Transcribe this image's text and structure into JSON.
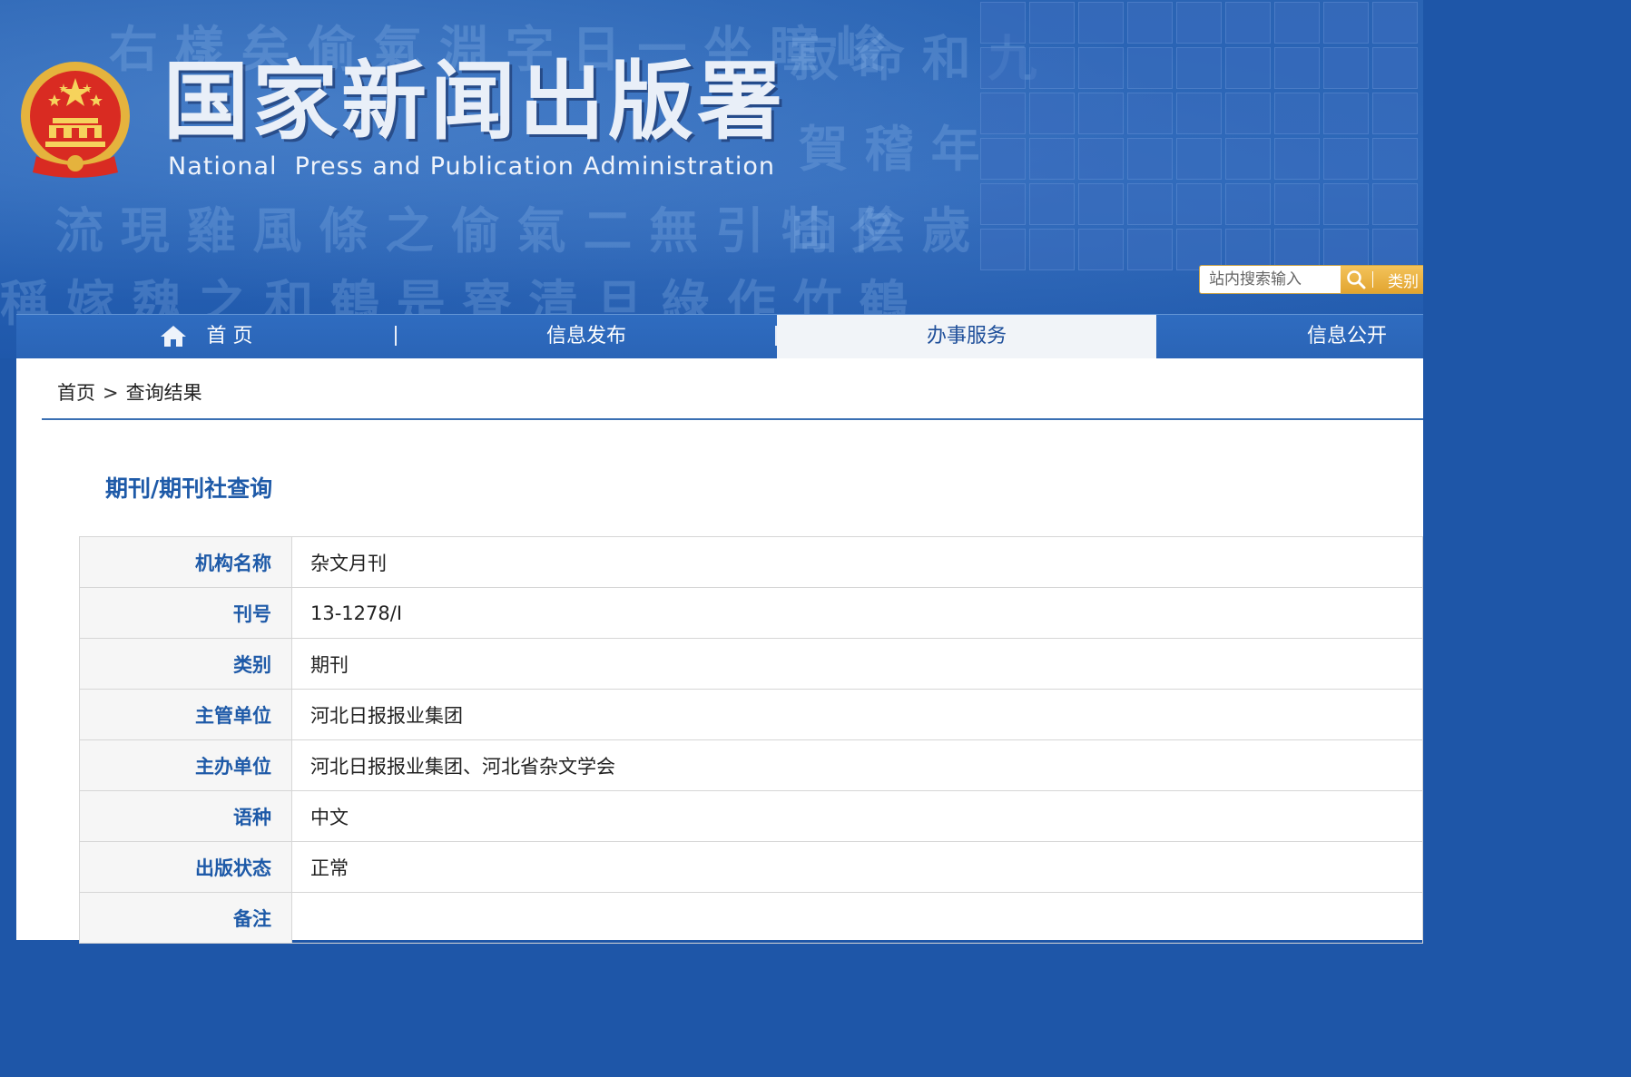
{
  "header": {
    "title": "国家新闻出版署",
    "subtitle": "National  Press and Publication Administration"
  },
  "search": {
    "placeholder": "站内搜索输入",
    "category_label": "类别"
  },
  "nav": {
    "items": [
      {
        "label": "首 页"
      },
      {
        "label": "信息发布"
      },
      {
        "label": "办事服务"
      },
      {
        "label": "信息公开"
      }
    ],
    "active_index": 2
  },
  "breadcrumb": {
    "home": "首页",
    "separator": ">",
    "current": "查询结果"
  },
  "section": {
    "title": "期刊/期刊社查询"
  },
  "record": {
    "rows": [
      {
        "label": "机构名称",
        "value": "杂文月刊"
      },
      {
        "label": "刊号",
        "value": "13-1278/I"
      },
      {
        "label": "类别",
        "value": "期刊"
      },
      {
        "label": "主管单位",
        "value": "河北日报报业集团"
      },
      {
        "label": "主办单位",
        "value": "河北日报报业集团、河北省杂文学会"
      },
      {
        "label": "语种",
        "value": "中文"
      },
      {
        "label": "出版状态",
        "value": "正常"
      },
      {
        "label": "备注",
        "value": ""
      }
    ]
  },
  "colors": {
    "brand_blue": "#2a64b6",
    "label_blue": "#1e5aa8",
    "search_gold": "#e2a530"
  }
}
